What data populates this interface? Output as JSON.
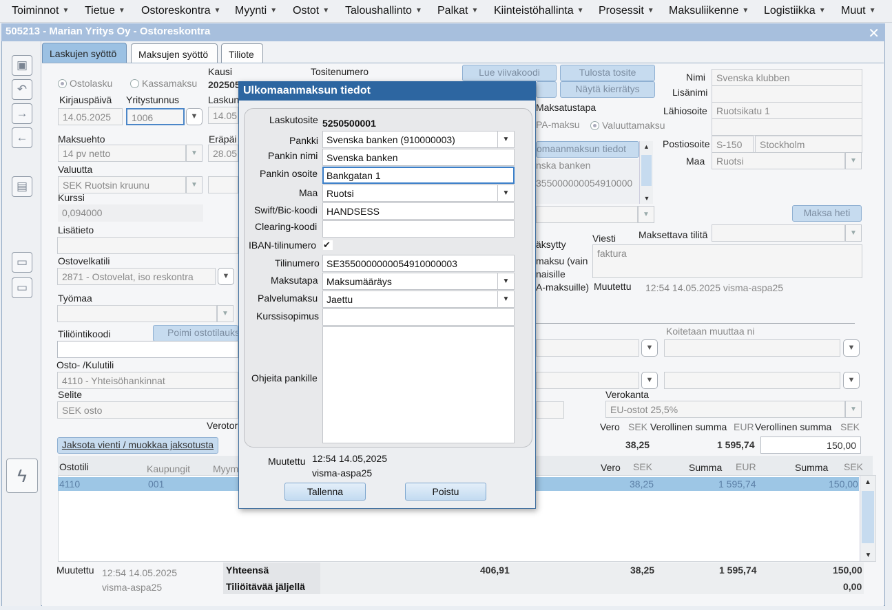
{
  "menubar": {
    "items": [
      "Toiminnot",
      "Tietue",
      "Ostoreskontra",
      "Myynti",
      "Ostot",
      "Taloushallinto",
      "Palkat",
      "Kiinteistöhallinta",
      "Prosessit",
      "Maksuliikenne",
      "Logistiikka",
      "Muut"
    ]
  },
  "window": {
    "title": "505213 - Marian Yritys Oy - Ostoreskontra",
    "close": "✕"
  },
  "tabs": [
    "Laskujen syöttö",
    "Maksujen syöttö",
    "Tiliote"
  ],
  "form": {
    "radio_ostolasku": "Ostolasku",
    "radio_kassamaksu": "Kassamaksu",
    "kausi_label": "Kausi",
    "kausi_value": "202505",
    "tositenumero_label": "Tositenumero",
    "tositenumero_value": "5250500001",
    "kirjauspaiva_label": "Kirjauspäivä",
    "kirjauspaiva_value": "14.05.2025",
    "yritystunnus_label": "Yritystunnus",
    "yritystunnus_value": "1006",
    "laskun_label": "Laskun",
    "laskun_value": "14.05.",
    "maksuehto_label": "Maksuehto",
    "maksuehto_value": "14 pv netto",
    "erapaiva_label": "Eräpäi",
    "erapaiva_value": "28.05.",
    "valuutta_label": "Valuutta",
    "valuutta_value": "SEK Ruotsin kruunu",
    "kurssi_label": "Kurssi",
    "kurssi_value": "0,094000",
    "lisatieto_label": "Lisätieto",
    "ostovelkatili_label": "Ostovelkatili",
    "ostovelkatili_value": "2871 - Ostovelat, iso reskontra",
    "tyomaa_label": "Työmaa",
    "tiliointikoodi_label": "Tiliöintikoodi",
    "poimi_button": "Poimi ostotilauks",
    "ostokulutili_label": "Osto- /Kulutili",
    "ostokulutili_value": "4110 - Yhteisöhankinnat",
    "selite_label": "Selite",
    "selite_value": "SEK osto",
    "verotor_label": "Verotor",
    "jaksota_button": "Jaksota vienti / muokkaa jaksotusta",
    "lue_viivakoodi": "Lue viivakoodi",
    "tulosta_tosite": "Tulosta tosite",
    "nayta_kierratys": "Näytä kierrätys",
    "maksatustapa_label": "Maksatustapa",
    "pa_maksu": "PA-maksu",
    "valuuttamaksu": "Valuuttamaksu",
    "ulkomaanmaksun_btn": "omaanmaksun tiedot",
    "bank_list_1": "nska banken",
    "bank_list_2": "355000000054910000",
    "maksa_heti": "Maksa heti",
    "aksytty": "äksytty",
    "maksu_vain": "maksu (vain",
    "naisille": "naisille",
    "a_maksuille": "A-maksuille)",
    "viesti_label": "Viesti",
    "viesti_value": "faktura",
    "maksettava_tilita_label": "Maksettava tilitä",
    "muutettu_label": "Muutettu",
    "muutettu_value": "12:54 14.05.2025 visma-aspa25",
    "koitetaan": "Koitetaan muuttaa ni",
    "verokanta_label": "Verokanta",
    "verokanta_value": "EU-ostot 25,5%",
    "vero_label": "Vero",
    "sek1": "SEK",
    "verollinen_summa_eur_label": "Verollinen summa",
    "eur1": "EUR",
    "verollinen_summa_sek_label": "Verollinen summa",
    "sek2": "SEK",
    "vero_value": "38,25",
    "verollinen_eur_value": "1 595,74",
    "verollinen_sek_value": "150,00"
  },
  "supplier": {
    "nimi_label": "Nimi",
    "nimi_value": "Svenska klubben",
    "lisanimi_label": "Lisänimi",
    "lahiosoite_label": "Lähiosoite",
    "lahiosoite_value": "Ruotsikatu 1",
    "postiosoite_label": "Postiosoite",
    "postinumero": "S-150",
    "postitoimipaikka": "Stockholm",
    "maa_label": "Maa",
    "maa_value": "Ruotsi"
  },
  "grid": {
    "headers": {
      "ostotili": "Ostotili",
      "kaupungit": "Kaupungit",
      "myym": "Myym",
      "vero": "Vero",
      "sek": "SEK",
      "summa_eur": "Summa",
      "eur": "EUR",
      "summa_sek": "Summa",
      "sek2": "SEK"
    },
    "row": {
      "ostotili": "4110",
      "kaupungit": "001",
      "vero": "38,25",
      "summa_eur": "1 595,74",
      "summa_sek": "150,00"
    }
  },
  "footer": {
    "muutettu_label": "Muutettu",
    "muutettu_time": "12:54 14.05.2025",
    "muutettu_user": "visma-aspa25",
    "yhteensa_label": "Yhteensä",
    "yhteensa_1": "406,91",
    "yhteensa_vero": "38,25",
    "yhteensa_eur": "1 595,74",
    "yhteensa_sek": "150,00",
    "jaljella_label": "Tiliöitävää jäljellä",
    "jaljella_value": "0,00"
  },
  "modal": {
    "title": "Ulkomaanmaksun tiedot",
    "laskutosite_label": "Laskutosite",
    "laskutosite_value": "5250500001",
    "pankki_label": "Pankki",
    "pankki_value": "Svenska banken (910000003)",
    "pankin_nimi_label": "Pankin nimi",
    "pankin_nimi_value": "Svenska banken",
    "pankin_osoite_label": "Pankin osoite",
    "pankin_osoite_value": "Bankgatan 1",
    "maa_label": "Maa",
    "maa_value": "Ruotsi",
    "swift_label": "Swift/Bic-koodi",
    "swift_value": "HANDSESS",
    "clearing_label": "Clearing-koodi",
    "iban_label": "IBAN-tilinumero",
    "tilinumero_label": "Tilinumero",
    "tilinumero_value": "SE3550000000054910000003",
    "maksutapa_label": "Maksutapa",
    "maksutapa_value": "Maksumääräys",
    "palvelumaksu_label": "Palvelumaksu",
    "palvelumaksu_value": "Jaettu",
    "kurssisopimus_label": "Kurssisopimus",
    "ohjeita_label": "Ohjeita pankille",
    "muutettu_label": "Muutettu",
    "muutettu_time": "12:54 14.05,2025",
    "muutettu_user": "visma-aspa25",
    "tallenna": "Tallenna",
    "poistu": "Poistu"
  }
}
